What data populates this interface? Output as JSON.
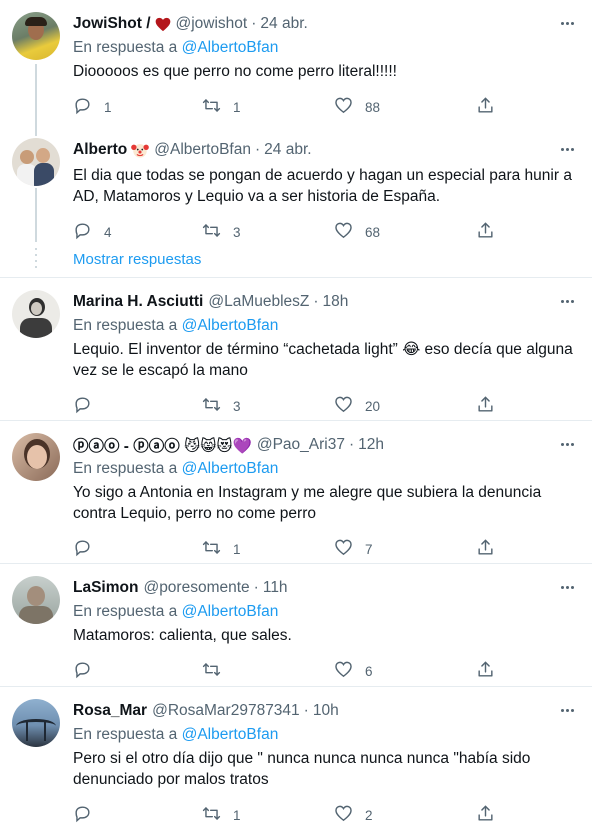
{
  "tweets": [
    {
      "name": "JowiShot /",
      "badge": "heart",
      "handle": "@jowishot",
      "time": "24 abr.",
      "reply_prefix": "En respuesta a",
      "reply_to": "@AlbertoBfan",
      "text": "Diooooos es que perro no come perro literal!!!!!",
      "replies": "1",
      "retweets": "1",
      "likes": "88",
      "avatar_colors": [
        "#7a8f6a",
        "#e6c84a"
      ]
    },
    {
      "name": "Alberto",
      "badge": "clown-emoji",
      "handle": "@AlbertoBfan",
      "time": "24 abr.",
      "text": "El dia que todas se pongan de acuerdo y hagan un especial para hunir a AD, Matamoros y Lequio va a ser historia de España.",
      "replies": "4",
      "retweets": "3",
      "likes": "68",
      "avatar_colors": [
        "#d9d4cc",
        "#5a6780"
      ]
    },
    {
      "name": "Marina H. Asciutti",
      "handle": "@LaMueblesZ",
      "time": "18h",
      "reply_prefix": "En respuesta a",
      "reply_to": "@AlbertoBfan",
      "text": "Lequio. El inventor de término “cachetada light” 😂 eso decía que alguna vez se le escapó la mano",
      "replies": "",
      "retweets": "3",
      "likes": "20",
      "avatar_colors": [
        "#e8e6e2",
        "#3a3a3a"
      ]
    },
    {
      "name": "ⓟⓐⓞ - ⓟⓐⓞ 😼😸😻💜",
      "handle": "@Pao_Ari37",
      "time": "12h",
      "reply_prefix": "En respuesta a",
      "reply_to": "@AlbertoBfan",
      "text": "Yo sigo a Antonia en Instagram y me alegre que subiera la denuncia contra Lequio, perro no come perro",
      "replies": "",
      "retweets": "1",
      "likes": "7",
      "avatar_colors": [
        "#c9a48c",
        "#4a3328"
      ]
    },
    {
      "name": "LaSimon",
      "handle": "@poresomente",
      "time": "11h",
      "reply_prefix": "En respuesta a",
      "reply_to": "@AlbertoBfan",
      "text": "Matamoros: calienta, que sales.",
      "replies": "",
      "retweets": "",
      "likes": "6",
      "avatar_colors": [
        "#b8c2c0",
        "#8a7f70"
      ]
    },
    {
      "name": "Rosa_Mar",
      "handle": "@RosaMar29787341",
      "time": "10h",
      "reply_prefix": "En respuesta a",
      "reply_to": "@AlbertoBfan",
      "text": "Pero si el otro día dijo que \" nunca nunca nunca nunca \"había sido denunciado por malos tratos",
      "replies": "",
      "retweets": "1",
      "likes": "2",
      "avatar_colors": [
        "#6f8fb0",
        "#2b3440"
      ]
    }
  ],
  "show_replies": "Mostrar respuestas",
  "icons": {
    "reply": "reply-icon",
    "retweet": "retweet-icon",
    "like": "heart-icon",
    "share": "share-icon",
    "more": "more-icon"
  },
  "colors": {
    "link": "#1d9bf0",
    "secondary": "#536471",
    "heart_badge": "#b4161b"
  }
}
